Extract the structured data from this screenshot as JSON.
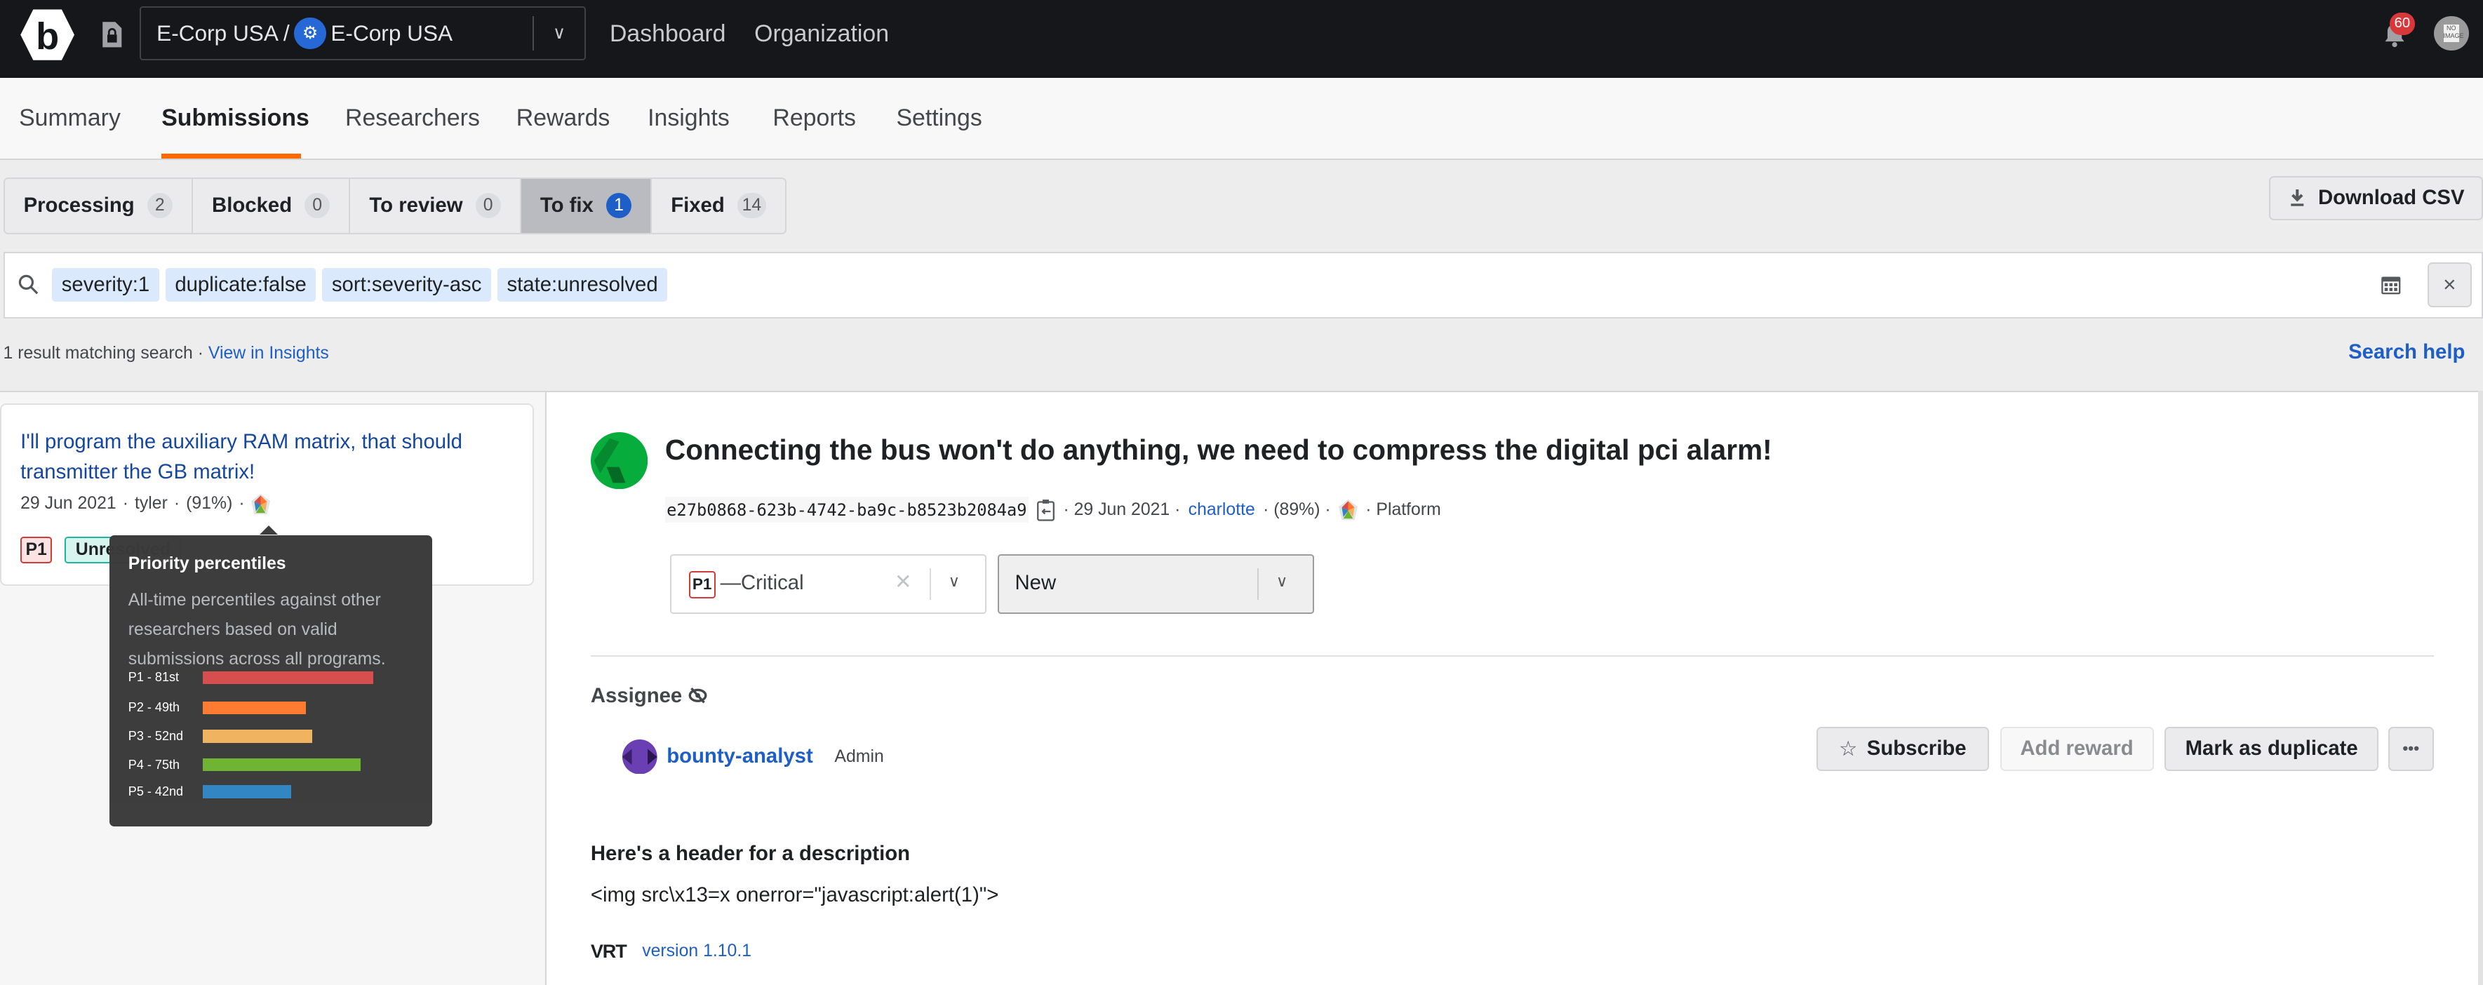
{
  "topbar": {
    "org_parent": "E-Corp USA /",
    "org_name": "E-Corp USA",
    "nav": [
      "Dashboard",
      "Organization"
    ],
    "notification_count": "60",
    "avatar_text": "NO IMAGE"
  },
  "subnav": {
    "tabs": [
      "Summary",
      "Submissions",
      "Researchers",
      "Rewards",
      "Insights",
      "Reports",
      "Settings"
    ],
    "active": "Submissions"
  },
  "state_tabs": [
    {
      "label": "Processing",
      "count": "2"
    },
    {
      "label": "Blocked",
      "count": "0"
    },
    {
      "label": "To review",
      "count": "0"
    },
    {
      "label": "To fix",
      "count": "1",
      "active": true
    },
    {
      "label": "Fixed",
      "count": "14"
    }
  ],
  "download_csv": "Download CSV",
  "search": {
    "chips": [
      "severity:1",
      "duplicate:false",
      "sort:severity-asc",
      "state:unresolved"
    ],
    "clear_label": "×"
  },
  "results": {
    "count_text": "1 result matching search",
    "separator": "·",
    "view_in_insights": "View in Insights",
    "search_help": "Search help"
  },
  "list": {
    "items": [
      {
        "title": "I'll program the auxiliary RAM matrix, that should transmitter the GB matrix!",
        "date": "29 Jun 2021",
        "researcher": "tyler",
        "percent": "(91%)",
        "priority": "P1",
        "state": "Unresolved"
      }
    ]
  },
  "tooltip": {
    "title": "Priority percentiles",
    "description": "All-time percentiles against other researchers based on valid submissions across all programs.",
    "rows": [
      {
        "label": "P1 - 81st",
        "percentile": 81,
        "color": "#d64b4b"
      },
      {
        "label": "P2 - 49th",
        "percentile": 49,
        "color": "#ff7a2e"
      },
      {
        "label": "P3 - 52nd",
        "percentile": 52,
        "color": "#f0b25e"
      },
      {
        "label": "P4 - 75th",
        "percentile": 75,
        "color": "#6db32f"
      },
      {
        "label": "P5 - 42nd",
        "percentile": 42,
        "color": "#2f84c3"
      }
    ]
  },
  "detail": {
    "title": "Connecting the bus won't do anything, we need to compress the digital pci alarm!",
    "uuid": "e27b0868-623b-4742-ba9c-b8523b2084a9",
    "date": "· 29 Jun 2021 ·",
    "researcher": "charlotte",
    "percent": "· (89%) ·",
    "target": "· Platform",
    "severity": {
      "badge": "P1",
      "label": "—Critical"
    },
    "status": "New",
    "assignee_label": "Assignee",
    "assignee_name": "bounty-analyst",
    "assignee_role": "Admin",
    "buttons": {
      "subscribe": "Subscribe",
      "add_reward": "Add reward",
      "mark_duplicate": "Mark as duplicate",
      "more": "•••"
    },
    "description_header": "Here's a header for a description",
    "description_body": "<img src\\x13=x onerror=\"javascript:alert(1)\">",
    "vrt_logo": "VRT",
    "vrt_version": "version 1.10.1"
  },
  "colors": {
    "accent": "#ff6a00",
    "link": "#1d5fc6",
    "topbar": "#16171b"
  }
}
